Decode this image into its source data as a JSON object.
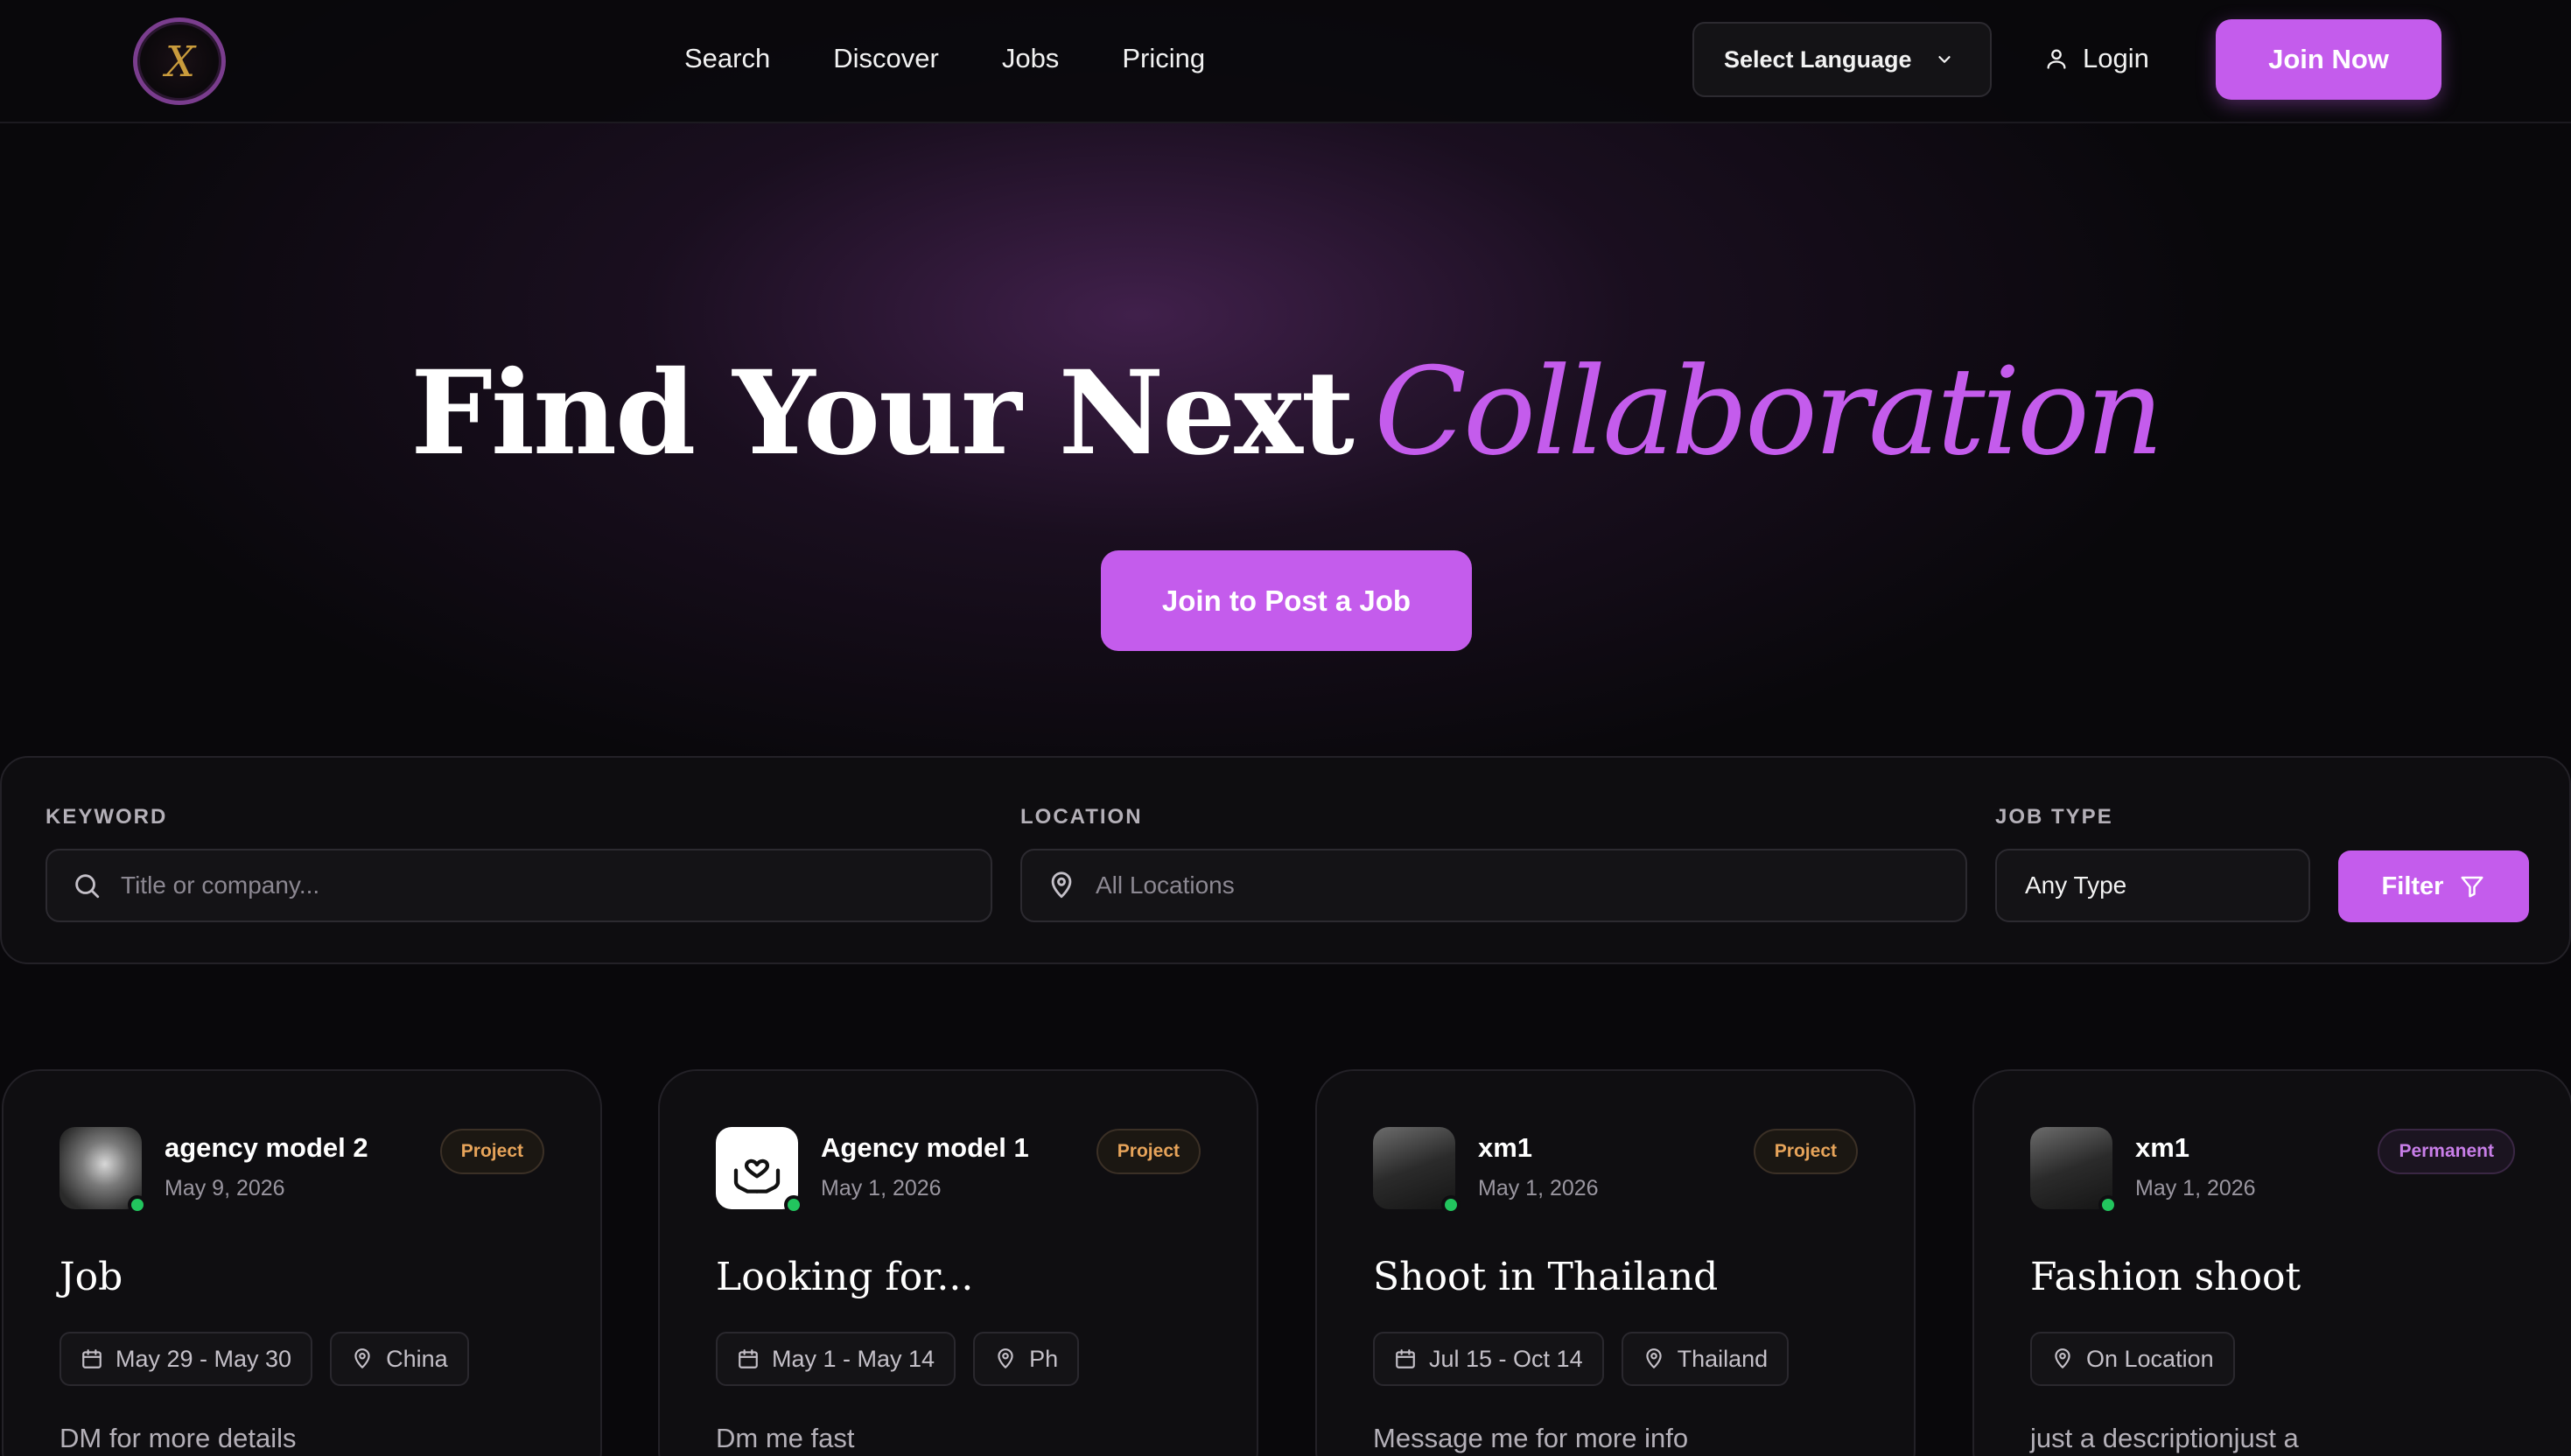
{
  "nav": {
    "links": [
      "Search",
      "Discover",
      "Jobs",
      "Pricing"
    ],
    "language_label": "Select Language",
    "login_label": "Login",
    "join_label": "Join Now"
  },
  "hero": {
    "title_plain": "Find Your Next",
    "title_script": "Collaboration",
    "cta_label": "Join to Post a Job"
  },
  "search": {
    "keyword_label": "KEYWORD",
    "keyword_placeholder": "Title or company...",
    "location_label": "LOCATION",
    "location_placeholder": "All Locations",
    "type_label": "JOB TYPE",
    "type_value": "Any Type",
    "filter_label": "Filter"
  },
  "jobs": [
    {
      "name": "agency model 2",
      "date": "May 9, 2026",
      "badge": "Project",
      "title": "Job",
      "dates": "May 29 - May 30",
      "location": "China",
      "description": "DM for more details"
    },
    {
      "name": "Agency model 1",
      "date": "May 1, 2026",
      "badge": "Project",
      "title": "Looking for...",
      "dates": "May 1 - May 14",
      "location": "Ph",
      "description": "Dm me fast"
    },
    {
      "name": "xm1",
      "date": "May 1, 2026",
      "badge": "Project",
      "title": "Shoot in Thailand",
      "dates": "Jul 15 - Oct 14",
      "location": "Thailand",
      "description": "Message me for more info"
    },
    {
      "name": "xm1",
      "date": "May 1, 2026",
      "badge": "Permanent",
      "title": "Fashion shoot",
      "location": "On Location",
      "description": "just a descriptionjust a"
    }
  ],
  "colors": {
    "accent": "#c45cec",
    "background": "#09080b",
    "online": "#22c55e",
    "project_badge": "#e7a45a",
    "permanent_badge": "#c87ee8"
  }
}
